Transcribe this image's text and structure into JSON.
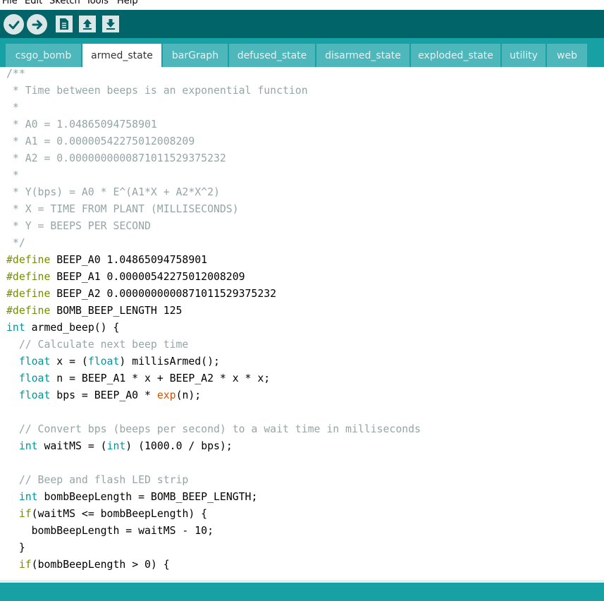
{
  "menu": [
    "File",
    "Edit",
    "Sketch",
    "Tools",
    "Help"
  ],
  "toolbar": {
    "verify_icon": "checkmark-icon",
    "upload_icon": "arrow-right-icon",
    "new_icon": "document-icon",
    "open_icon": "arrow-up-icon",
    "save_icon": "arrow-down-icon"
  },
  "tabs": [
    "csgo_bomb",
    "armed_state",
    "barGraph",
    "defused_state",
    "disarmed_state",
    "exploded_state",
    "utility",
    "web"
  ],
  "active_tab": "armed_state",
  "code_lines": [
    [
      [
        "c",
        "/**"
      ]
    ],
    [
      [
        "c",
        " * Time between beeps is an exponential function"
      ]
    ],
    [
      [
        "c",
        " *"
      ]
    ],
    [
      [
        "c",
        " * A0 = 1.04865094758901"
      ]
    ],
    [
      [
        "c",
        " * A1 = 0.00000542275012008209"
      ]
    ],
    [
      [
        "c",
        " * A2 = 0.0000000000871011529375232"
      ]
    ],
    [
      [
        "c",
        " *"
      ]
    ],
    [
      [
        "c",
        " * Y(bps) = A0 * E^(A1*X + A2*X^2)"
      ]
    ],
    [
      [
        "c",
        " * X = TIME FROM PLANT (MILLISECONDS)"
      ]
    ],
    [
      [
        "c",
        " * Y = BEEPS PER SECOND"
      ]
    ],
    [
      [
        "c",
        " */"
      ]
    ],
    [
      [
        "kw",
        "#define"
      ],
      [
        "n",
        " BEEP_A0 1.04865094758901"
      ]
    ],
    [
      [
        "kw",
        "#define"
      ],
      [
        "n",
        " BEEP_A1 0.00000542275012008209"
      ]
    ],
    [
      [
        "kw",
        "#define"
      ],
      [
        "n",
        " BEEP_A2 0.0000000000871011529375232"
      ]
    ],
    [
      [
        "kw",
        "#define"
      ],
      [
        "n",
        " BOMB_BEEP_LENGTH 125"
      ]
    ],
    [
      [
        "ty",
        "int"
      ],
      [
        "n",
        " armed_beep() {"
      ]
    ],
    [
      [
        "c",
        "  // Calculate next beep time"
      ]
    ],
    [
      [
        "n",
        "  "
      ],
      [
        "ty",
        "float"
      ],
      [
        "n",
        " x = ("
      ],
      [
        "ty",
        "float"
      ],
      [
        "n",
        ") millisArmed();"
      ]
    ],
    [
      [
        "n",
        "  "
      ],
      [
        "ty",
        "float"
      ],
      [
        "n",
        " n = BEEP_A1 * x + BEEP_A2 * x * x;"
      ]
    ],
    [
      [
        "n",
        "  "
      ],
      [
        "ty",
        "float"
      ],
      [
        "n",
        " bps = BEEP_A0 * "
      ],
      [
        "fn",
        "exp"
      ],
      [
        "n",
        "(n);"
      ]
    ],
    [
      [
        "n",
        ""
      ]
    ],
    [
      [
        "c",
        "  // Convert bps (beeps per second) to a wait time in milliseconds"
      ]
    ],
    [
      [
        "n",
        "  "
      ],
      [
        "ty",
        "int"
      ],
      [
        "n",
        " waitMS = ("
      ],
      [
        "ty",
        "int"
      ],
      [
        "n",
        ") (1000.0 / bps);"
      ]
    ],
    [
      [
        "n",
        ""
      ]
    ],
    [
      [
        "c",
        "  // Beep and flash LED strip"
      ]
    ],
    [
      [
        "n",
        "  "
      ],
      [
        "ty",
        "int"
      ],
      [
        "n",
        " bombBeepLength = BOMB_BEEP_LENGTH;"
      ]
    ],
    [
      [
        "n",
        "  "
      ],
      [
        "kw",
        "if"
      ],
      [
        "n",
        "(waitMS <= bombBeepLength) {"
      ]
    ],
    [
      [
        "n",
        "    bombBeepLength = waitMS - 10;"
      ]
    ],
    [
      [
        "n",
        "  }"
      ]
    ],
    [
      [
        "n",
        "  "
      ],
      [
        "kw",
        "if"
      ],
      [
        "n",
        "(bombBeepLength > 0) {"
      ]
    ]
  ]
}
